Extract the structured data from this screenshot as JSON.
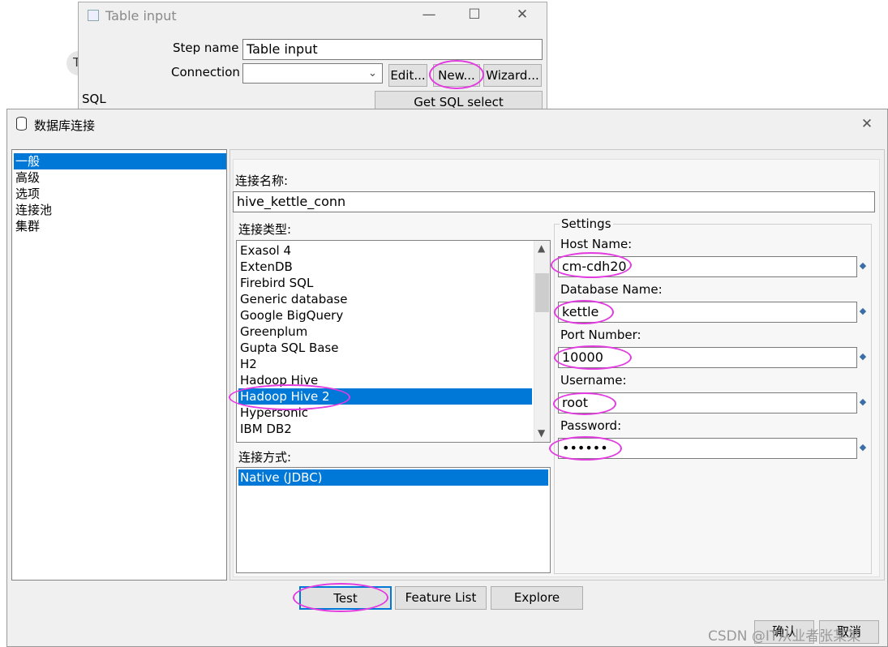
{
  "background": {
    "node_letter": "T"
  },
  "table_input": {
    "title": "Table input",
    "step_name_label": "Step name",
    "step_name_value": "Table input",
    "connection_label": "Connection",
    "connection_value": "",
    "edit_button": "Edit...",
    "new_button": "New...",
    "wizard_button": "Wizard...",
    "sql_label": "SQL",
    "get_sql_button": "Get SQL select statement..."
  },
  "db_dialog": {
    "title": "数据库连接",
    "nav": [
      "一般",
      "高级",
      "选项",
      "连接池",
      "集群"
    ],
    "nav_selected": 0,
    "conn_name_label": "连接名称:",
    "conn_name_value": "hive_kettle_conn",
    "conn_type_label": "连接类型:",
    "conn_types": [
      "Exasol 4",
      "ExtenDB",
      "Firebird SQL",
      "Generic database",
      "Google BigQuery",
      "Greenplum",
      "Gupta SQL Base",
      "H2",
      "Hadoop Hive",
      "Hadoop Hive 2",
      "Hypersonic",
      "IBM DB2"
    ],
    "conn_type_selected": 9,
    "access_label": "连接方式:",
    "access_methods": [
      "Native (JDBC)"
    ],
    "settings": {
      "legend": "Settings",
      "host_label": "Host Name:",
      "host_value": "cm-cdh20",
      "db_label": "Database Name:",
      "db_value": "kettle",
      "port_label": "Port Number:",
      "port_value": "10000",
      "user_label": "Username:",
      "user_value": "root",
      "password_label": "Password:",
      "password_value": "••••••"
    },
    "footer": {
      "test": "Test",
      "feature_list": "Feature List",
      "explore": "Explore",
      "ok": "确认",
      "cancel": "取消"
    }
  },
  "watermark": "CSDN @IT从业者张某某",
  "colors": {
    "selection": "#0078d7",
    "highlight_ring": "#e23be0"
  }
}
